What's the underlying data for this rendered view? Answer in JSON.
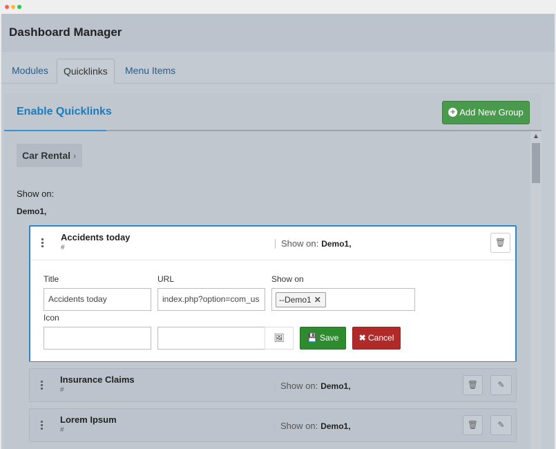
{
  "window": {
    "dots": [
      "#ff5f57",
      "#febc2e",
      "#28c840"
    ]
  },
  "app": {
    "title": "Dashboard Manager"
  },
  "tabs": [
    {
      "label": "Modules"
    },
    {
      "label": "Quicklinks"
    },
    {
      "label": "Menu Items"
    }
  ],
  "panel": {
    "title": "Enable Quicklinks",
    "add_group_label": "Add New Group"
  },
  "group": {
    "name": "Car Rental",
    "show_on_label": "Show on:",
    "show_on_value": "Demo1,"
  },
  "items": [
    {
      "name": "Accidents today",
      "link": "#",
      "show_on_label": "Show on:",
      "show_on_value": "Demo1,"
    },
    {
      "name": "Insurance Claims",
      "link": "#",
      "show_on_label": "Show on:",
      "show_on_value": "Demo1,"
    },
    {
      "name": "Lorem Ipsum",
      "link": "#",
      "show_on_label": "Show on:",
      "show_on_value": "Demo1,"
    }
  ],
  "editor": {
    "title_label": "Title",
    "title_value": "Accidents today",
    "url_label": "URL",
    "url_value": "index.php?option=com_us",
    "showon_label": "Show on",
    "showon_chip": "--Demo1",
    "icon_label": "Icon",
    "icon_value": "",
    "save_label": "Save",
    "cancel_label": "Cancel"
  },
  "colors": {
    "accent": "#1a7bbf",
    "success": "#2e8b2e",
    "danger": "#b02a2a",
    "add": "#4a9a4e"
  }
}
